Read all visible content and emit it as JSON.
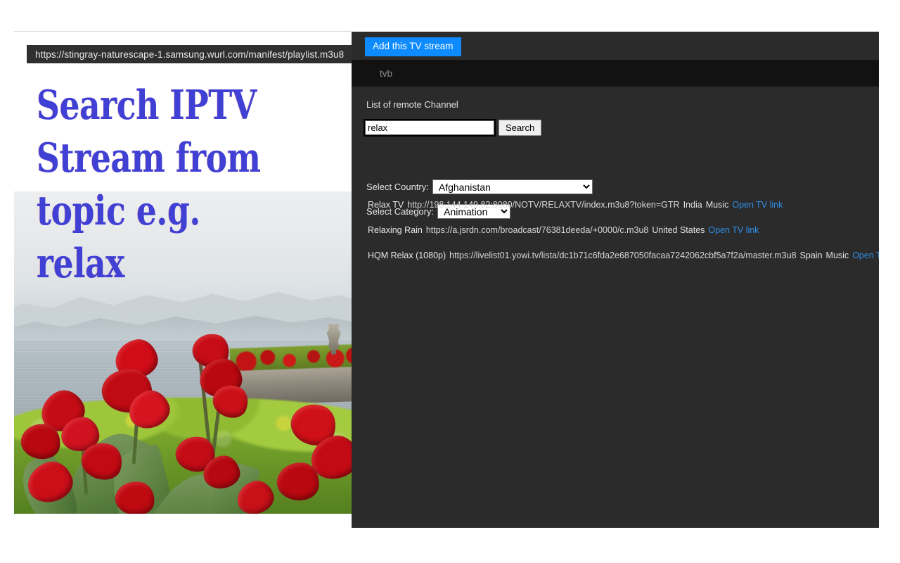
{
  "browser": {
    "url": "https://stingray-naturescape-1.samsung.wurl.com/manifest/playlist.m3u8"
  },
  "page": {
    "headline": "Search IPTV Stream from topic e.g. relax",
    "photo_alt": "Red canna lily flowers in a lakeside garden with misty mountains"
  },
  "panel": {
    "add_stream_label": "Add this TV stream",
    "stream_name_value": "tvb",
    "stream_name_placeholder": "tvb",
    "list_label": "List of remote Channel",
    "search": {
      "value": "relax",
      "placeholder": "",
      "button_label": "Search"
    },
    "country": {
      "label": "Select Country:",
      "selected": "Afghanistan",
      "options": [
        "Afghanistan"
      ]
    },
    "category": {
      "label": "Select Category:",
      "selected": "Animation",
      "options": [
        "Animation"
      ]
    },
    "results": [
      {
        "name": "Relax TV",
        "url": "http://198.144.149.82:8080/NOTV/RELAXTV/index.m3u8?token=GTR",
        "country": "India",
        "category": "Music",
        "link_label": "Open TV link"
      },
      {
        "name": "Relaxing Rain",
        "url": "https://a.jsrdn.com/broadcast/76381deeda/+0000/c.m3u8",
        "country": "United States",
        "category": "",
        "link_label": "Open TV link"
      },
      {
        "name": "HQM Relax (1080p)",
        "url": "https://livelist01.yowi.tv/lista/dc1b71c6fda2e687050facaa7242062cbf5a7f2a/master.m3u8",
        "country": "Spain",
        "category": "Music",
        "link_label": "Open TV link"
      }
    ]
  },
  "colors": {
    "accent_blue": "#0d8bff",
    "link_blue": "#2e8fe8",
    "panel_bg": "#2b2b2b",
    "band_bg": "#121212",
    "headline_blue": "#4040d4"
  }
}
